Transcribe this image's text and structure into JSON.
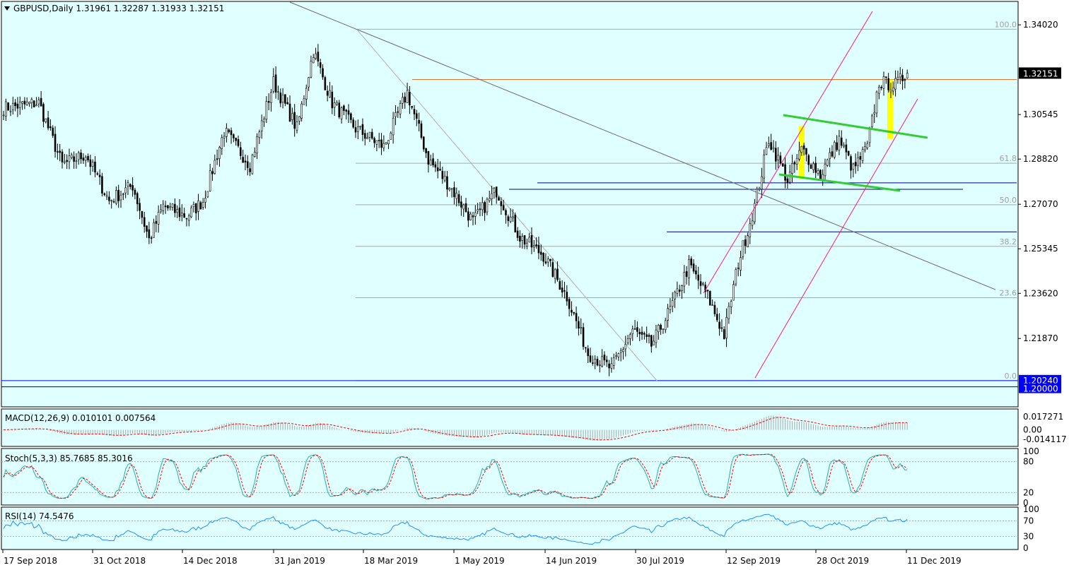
{
  "colors": {
    "background": "#e0ffff",
    "border": "#000000",
    "candle": "#000000",
    "resistance_line": "#d2691e",
    "support_line": "#00008b",
    "channel_line": "#ff1493",
    "flag_line": "#32cd32",
    "highlight_bar": "#ffff00",
    "trend_line": "#6b6b6b",
    "fib_line": "#a9a9a9",
    "macd_line": "#ff0000",
    "macd_hist": "#a9a9a9",
    "stoch_main": "#20b2aa",
    "stoch_signal": "#ff0000",
    "rsi_line": "#1e90ff",
    "price_tag_bg": "#000000",
    "level_tag_bg": "#0000ff"
  },
  "main_panel": {
    "header": "GBPUSD,Daily  1.31961 1.32287 1.31933 1.32151",
    "y_ticks": [
      "1.34020",
      "1.30545",
      "1.28820",
      "1.27070",
      "1.25345",
      "1.23620",
      "1.21870"
    ],
    "current_price": "1.32151",
    "level_tags": [
      "1.20240",
      "1.20000"
    ],
    "fib_labels": [
      "100.0",
      "61.8",
      "50.0",
      "38.2",
      "23.6",
      "0.0"
    ]
  },
  "macd_panel": {
    "label": "MACD(12,26,9) 0.010101 0.007564",
    "y_ticks": [
      "0.017271",
      "0.00",
      "-0.014117"
    ]
  },
  "stoch_panel": {
    "label": "Stoch(5,3,3) 85.7685 85.3016",
    "y_ticks": [
      "100",
      "80",
      "20",
      "0"
    ]
  },
  "rsi_panel": {
    "label": "RSI(14) 74.5476",
    "y_ticks": [
      "100",
      "70",
      "30",
      "0"
    ]
  },
  "x_axis": {
    "labels": [
      "17 Sep 2018",
      "31 Oct 2018",
      "14 Dec 2018",
      "31 Jan 2019",
      "18 Mar 2019",
      "1 May 2019",
      "14 Jun 2019",
      "30 Jul 2019",
      "12 Sep 2019",
      "28 Oct 2019",
      "11 Dec 2019"
    ]
  },
  "chart_data": {
    "type": "candlestick",
    "symbol": "GBPUSD",
    "timeframe": "Daily",
    "ohlc_last": {
      "open": 1.31961,
      "high": 1.32287,
      "low": 1.31933,
      "close": 1.32151
    },
    "ylim": [
      1.1925,
      1.349
    ],
    "anchors": [
      [
        0,
        1.308
      ],
      [
        15,
        1.31
      ],
      [
        25,
        1.286
      ],
      [
        35,
        1.29
      ],
      [
        45,
        1.272
      ],
      [
        55,
        1.278
      ],
      [
        62,
        1.257
      ],
      [
        68,
        1.27
      ],
      [
        78,
        1.266
      ],
      [
        85,
        1.272
      ],
      [
        94,
        1.299
      ],
      [
        105,
        1.286
      ],
      [
        115,
        1.318
      ],
      [
        125,
        1.3
      ],
      [
        132,
        1.33
      ],
      [
        140,
        1.31
      ],
      [
        150,
        1.3
      ],
      [
        162,
        1.293
      ],
      [
        172,
        1.314
      ],
      [
        181,
        1.288
      ],
      [
        190,
        1.278
      ],
      [
        200,
        1.264
      ],
      [
        210,
        1.276
      ],
      [
        220,
        1.258
      ],
      [
        230,
        1.251
      ],
      [
        240,
        1.235
      ],
      [
        249,
        1.213
      ],
      [
        259,
        1.207
      ],
      [
        268,
        1.222
      ],
      [
        276,
        1.216
      ],
      [
        284,
        1.23
      ],
      [
        292,
        1.247
      ],
      [
        300,
        1.235
      ],
      [
        307,
        1.22
      ],
      [
        313,
        1.248
      ],
      [
        320,
        1.27
      ],
      [
        326,
        1.296
      ],
      [
        334,
        1.28
      ],
      [
        340,
        1.292
      ],
      [
        348,
        1.282
      ],
      [
        356,
        1.296
      ],
      [
        362,
        1.284
      ],
      [
        368,
        1.293
      ],
      [
        373,
        1.318
      ],
      [
        380,
        1.317
      ],
      [
        385,
        1.3215
      ]
    ],
    "total_bars": 386,
    "fibonacci": {
      "0.0": 1.2024,
      "23.6": 1.2345,
      "38.2": 1.2544,
      "50.0": 1.2705,
      "61.8": 1.2866,
      "100.0": 1.3385
    },
    "horizontal_levels": [
      1.319,
      1.279,
      1.2765,
      1.26,
      1.2024,
      1.2
    ],
    "macd": {
      "main": 0.010101,
      "signal": 0.007564,
      "ylim": [
        -0.016,
        0.019
      ]
    },
    "stochastic": {
      "k": 85.7685,
      "d": 85.3016,
      "levels": [
        20,
        80
      ]
    },
    "rsi": {
      "value": 74.5476,
      "levels": [
        30,
        70
      ]
    }
  }
}
